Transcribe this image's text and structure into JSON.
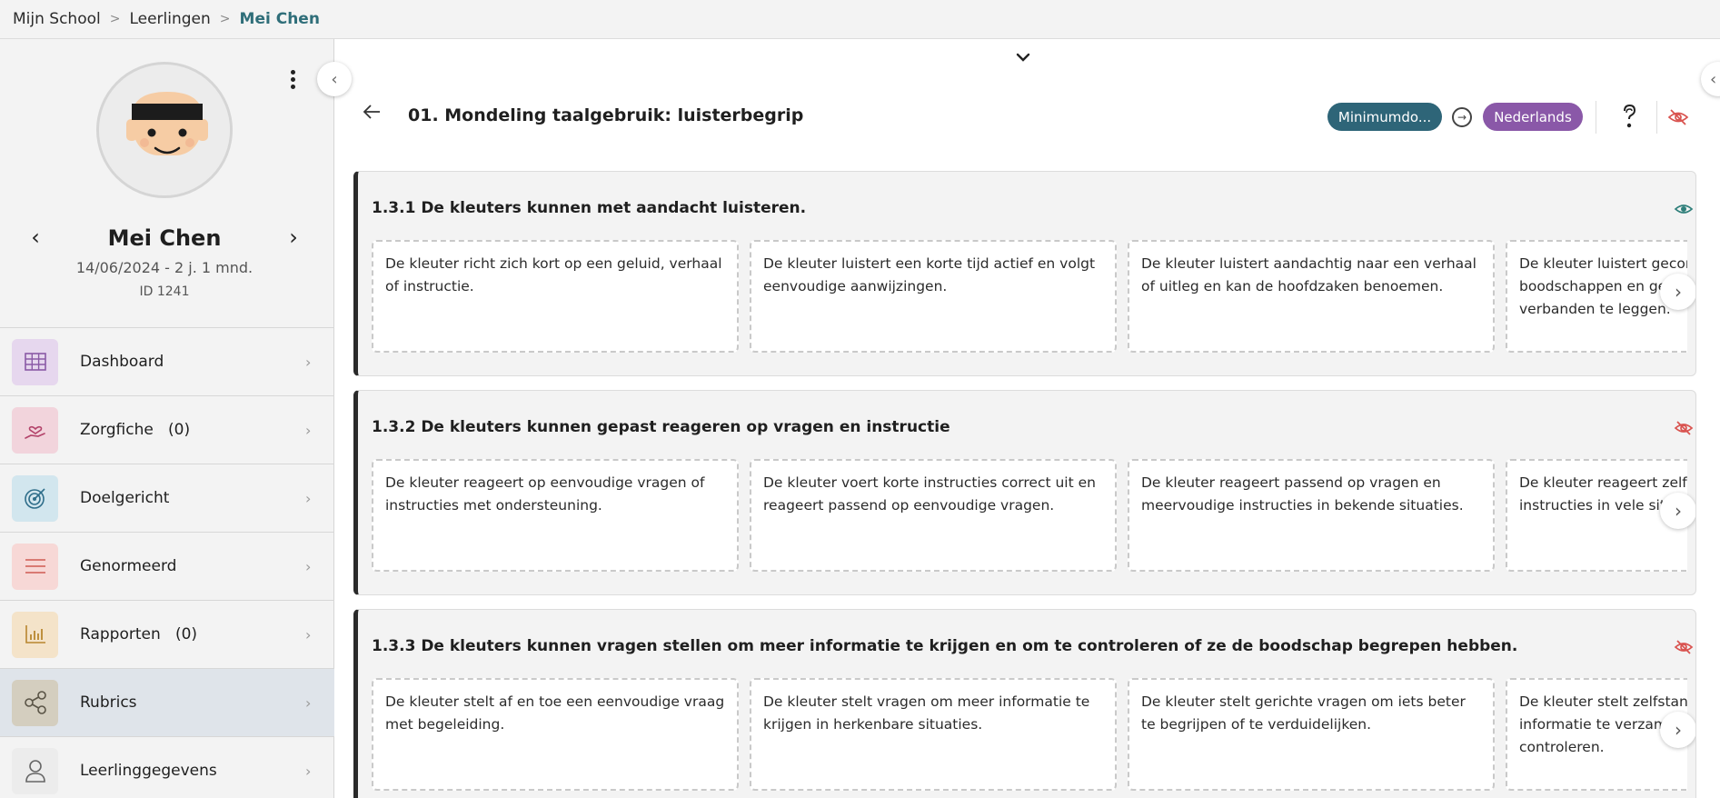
{
  "breadcrumb": {
    "items": [
      "Mijn School",
      "Leerlingen"
    ],
    "current": "Mei Chen",
    "separator": ">"
  },
  "student": {
    "name": "Mei Chen",
    "dob_age": "14/06/2024 - 2 j. 1 mnd.",
    "id": "ID 1241"
  },
  "menu": {
    "items": [
      {
        "label": "Dashboard",
        "icon": "grid-icon",
        "color": "#e6d7ee"
      },
      {
        "label": "Zorgfiche   (0)",
        "icon": "hand-heart-icon",
        "color": "#f2d4dc"
      },
      {
        "label": "Doelgericht",
        "icon": "target-icon",
        "color": "#d2e6ee"
      },
      {
        "label": "Genormeerd",
        "icon": "lines-icon",
        "color": "#f7d8d6"
      },
      {
        "label": "Rapporten   (0)",
        "icon": "bar-chart-icon",
        "color": "#f4e3c9"
      },
      {
        "label": "Rubrics",
        "icon": "share-icon",
        "color": "#d4cebf",
        "active": true
      },
      {
        "label": "Leerlinggegevens",
        "icon": "person-icon",
        "color": "#ececec"
      }
    ]
  },
  "header": {
    "title": "01. Mondeling taalgebruik: luisterbegrip",
    "level_pill": "Minimumdo...",
    "language_pill": "Nederlands",
    "colors": {
      "level": "#2e6578",
      "language": "#8a58a8",
      "hidden": "#d9534f",
      "visible": "#2f7f7a"
    }
  },
  "sections": [
    {
      "title": "1.3.1 De kleuters kunnen met aandacht luisteren.",
      "visible": true,
      "cards": [
        "De kleuter richt zich kort op een geluid, verhaal of instructie.",
        "De kleuter luistert een korte tijd actief en volgt eenvoudige aanwijzingen.",
        "De kleuter luistert aandachtig naar een verhaal of uitleg en kan de hoofdzaken benoemen.",
        "De kleuter luistert geconcentreerd naar boodschappen en gebruikt wat hij hoort om verbanden te leggen."
      ]
    },
    {
      "title": "1.3.2 De kleuters kunnen gepast reageren op vragen en instructie",
      "visible": false,
      "cards": [
        "De kleuter reageert op eenvoudige vragen of instructies met ondersteuning.",
        "De kleuter voert korte instructies correct uit en reageert passend op eenvoudige vragen.",
        "De kleuter reageert passend op vragen en meervoudige instructies in bekende situaties.",
        "De kleuter reageert zelfstandig op vragen en instructies in vele situaties."
      ]
    },
    {
      "title": "1.3.3 De kleuters kunnen vragen stellen om meer informatie te krijgen en om te controleren of ze de boodschap begrepen hebben.",
      "visible": false,
      "cards": [
        "De kleuter stelt af en toe een eenvoudige vraag met begeleiding.",
        "De kleuter stelt vragen om meer informatie te krijgen in herkenbare situaties.",
        "De kleuter stelt gerichte vragen om iets beter te begrijpen of te verduidelijken.",
        "De kleuter stelt zelfstandig vragen om informatie te verzamelen en zijn begrip te controleren."
      ]
    }
  ]
}
